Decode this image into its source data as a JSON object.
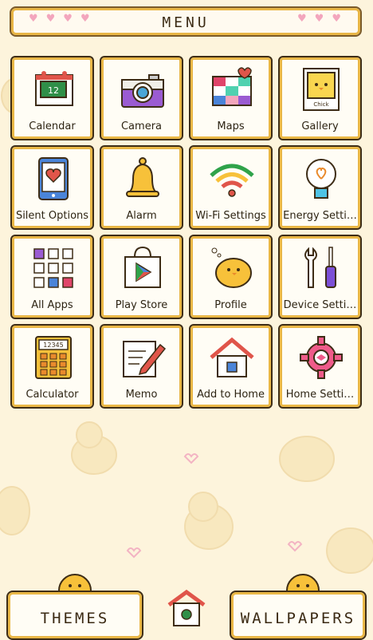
{
  "header": {
    "title": "MENU"
  },
  "apps": [
    {
      "label": "Calendar",
      "icon": "calendar-icon",
      "date": "12"
    },
    {
      "label": "Camera",
      "icon": "camera-icon"
    },
    {
      "label": "Maps",
      "icon": "maps-icon"
    },
    {
      "label": "Gallery",
      "icon": "gallery-icon",
      "caption": "Chick"
    },
    {
      "label": "Silent Options",
      "icon": "silent-phone-icon"
    },
    {
      "label": "Alarm",
      "icon": "bell-icon"
    },
    {
      "label": "Wi-Fi Settings",
      "icon": "wifi-icon"
    },
    {
      "label": "Energy Setti…",
      "icon": "lightbulb-icon"
    },
    {
      "label": "All Apps",
      "icon": "app-grid-icon"
    },
    {
      "label": "Play Store",
      "icon": "play-store-bag-icon"
    },
    {
      "label": "Profile",
      "icon": "chick-icon"
    },
    {
      "label": "Device Setti…",
      "icon": "tools-icon"
    },
    {
      "label": "Calculator",
      "icon": "calculator-icon",
      "display": "12345"
    },
    {
      "label": "Memo",
      "icon": "memo-pencil-icon"
    },
    {
      "label": "Add to Home",
      "icon": "house-icon"
    },
    {
      "label": "Home Setti…",
      "icon": "pink-gear-icon"
    }
  ],
  "bottom": {
    "themes_label": "THEMES",
    "wallpapers_label": "WALLPAPERS",
    "center_icon": "birdhouse-icon"
  },
  "colors": {
    "background": "#fdf4dc",
    "tile_border": "#3e2d16",
    "tile_accent": "#e9b746",
    "heart": "#f3a6bd"
  }
}
